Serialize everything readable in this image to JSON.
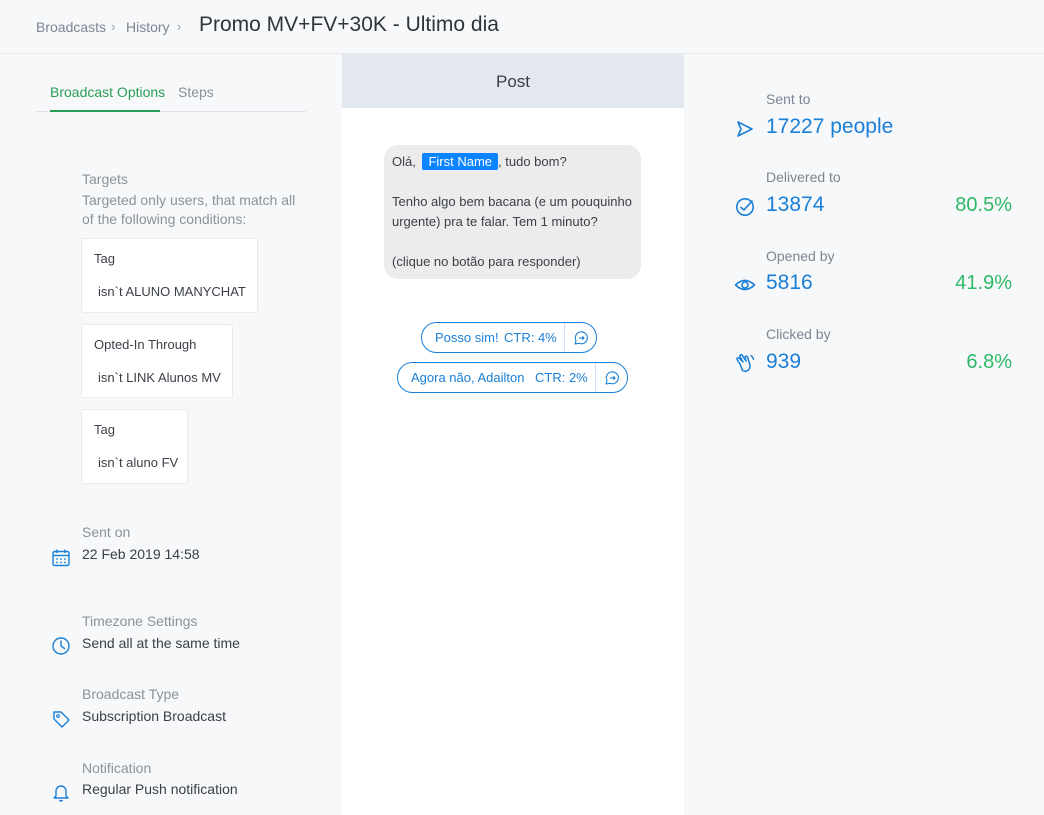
{
  "breadcrumb": {
    "broadcasts": "Broadcasts",
    "history": "History",
    "separator": "›"
  },
  "page_title": "Promo MV+FV+30K - Ultimo dia",
  "tabs": [
    {
      "label": "Broadcast Options",
      "active": true
    },
    {
      "label": "Steps",
      "active": false
    }
  ],
  "targets": {
    "label": "Targets",
    "description_line1": "Targeted only users, that match all",
    "description_line2": "of the following conditions:",
    "conditions": [
      {
        "title": "Tag",
        "value": "isn`t ALUNO MANYCHAT"
      },
      {
        "title": "Opted-In Through",
        "value": "isn`t LINK Alunos MV"
      },
      {
        "title": "Tag",
        "value": "isn`t aluno FV"
      }
    ]
  },
  "sent_on": {
    "label": "Sent on",
    "value": "22 Feb 2019 14:58",
    "icon": "calendar-icon"
  },
  "timezone": {
    "label": "Timezone Settings",
    "value": "Send all at the same time",
    "icon": "clock-icon"
  },
  "broadcast_type": {
    "label": "Broadcast Type",
    "value": "Subscription Broadcast",
    "icon": "tag-icon"
  },
  "notification": {
    "label": "Notification",
    "value": "Regular Push notification",
    "icon": "bell-icon"
  },
  "post": {
    "header": "Post",
    "message": {
      "greeting_prefix": "Olá,",
      "first_name_chip": "First Name",
      "greeting_suffix": ", tudo bom?",
      "line2": "Tenho algo bem bacana (e um pouquinho",
      "line3": "urgente) pra te falar. Tem 1 minuto?",
      "line4": "(clique no botão para responder)"
    },
    "quick_replies": [
      {
        "label": "Posso sim!",
        "ctr": "CTR: 4%"
      },
      {
        "label": "Agora não, Adailton",
        "ctr": "CTR: 2%"
      }
    ]
  },
  "stats": {
    "sent": {
      "label": "Sent to",
      "value": "17227 people"
    },
    "delivered": {
      "label": "Delivered to",
      "value": "13874",
      "percent": "80.5%"
    },
    "opened": {
      "label": "Opened by",
      "value": "5816",
      "percent": "41.9%"
    },
    "clicked": {
      "label": "Clicked by",
      "value": "939",
      "percent": "6.8%"
    }
  },
  "colors": {
    "accent_blue": "#1a7fd6",
    "accent_green": "#2a9d55",
    "percent_green": "#2fb866",
    "chip_blue": "#0a84ff"
  }
}
